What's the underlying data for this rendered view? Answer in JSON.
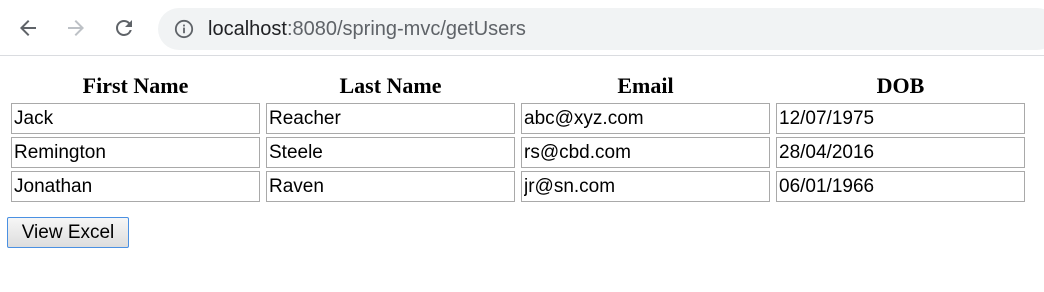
{
  "browser": {
    "url_host": "localhost",
    "url_rest": ":8080/spring-mvc/getUsers",
    "icons": {
      "back": "arrow-left-icon",
      "forward": "arrow-right-icon",
      "reload": "reload-icon",
      "info": "info-icon"
    }
  },
  "table": {
    "headers": [
      "First Name",
      "Last Name",
      "Email",
      "DOB"
    ],
    "rows": [
      [
        "Jack",
        "Reacher",
        "abc@xyz.com",
        "12/07/1975"
      ],
      [
        "Remington",
        "Steele",
        "rs@cbd.com",
        "28/04/2016"
      ],
      [
        "Jonathan",
        "Raven",
        "jr@sn.com",
        "06/01/1966"
      ]
    ]
  },
  "actions": {
    "view_excel_label": "View Excel"
  },
  "colors": {
    "toolbar_icon": "#5f6368",
    "toolbar_icon_disabled": "#bdc1c6",
    "omnibox_bg": "#f1f3f4",
    "button_focus_border": "#4a90e2"
  }
}
